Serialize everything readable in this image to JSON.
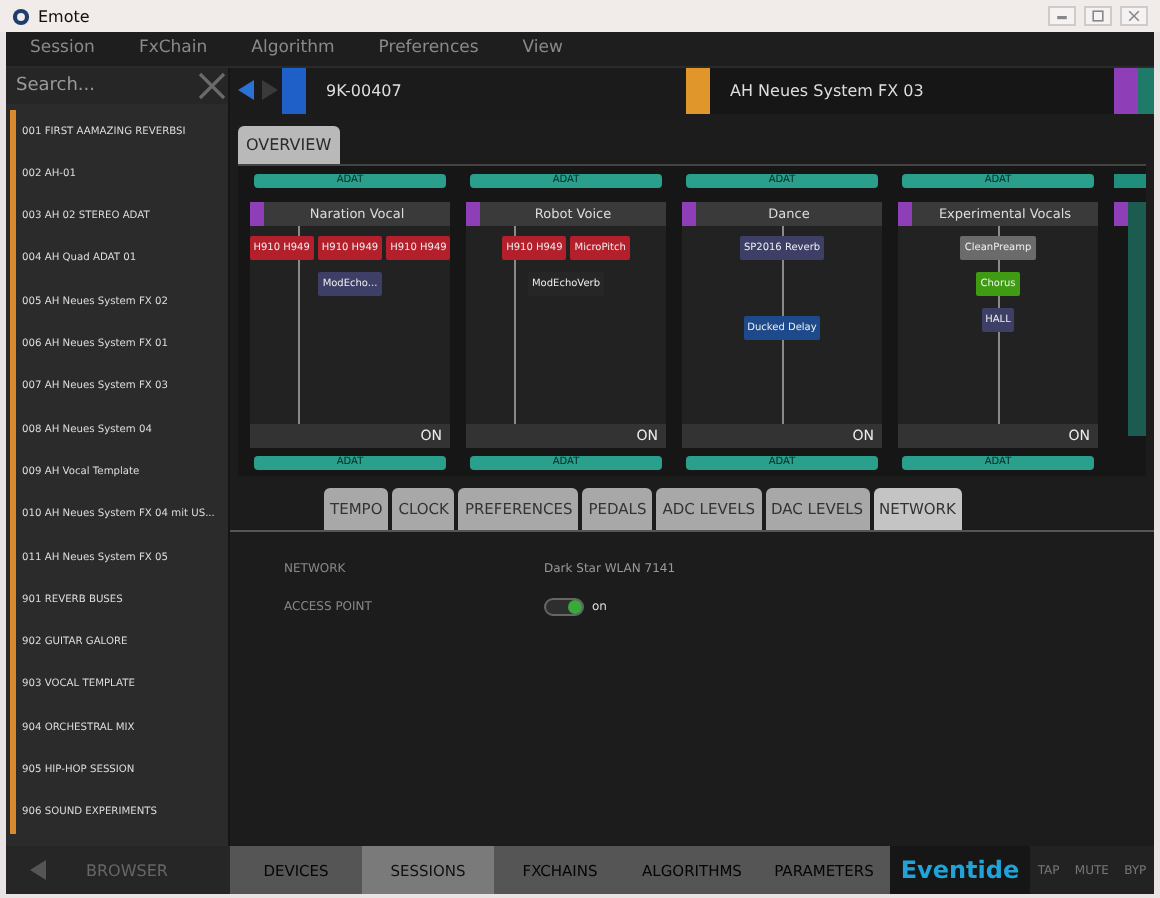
{
  "window": {
    "title": "Emote"
  },
  "menu": [
    "Session",
    "FxChain",
    "Algorithm",
    "Preferences",
    "View"
  ],
  "sidebar": {
    "search": {
      "placeholder": "Search..."
    },
    "items": [
      {
        "label": "001 FIRST AAMAZING REVERBSI",
        "selected": false
      },
      {
        "label": "002 AH-01",
        "selected": false
      },
      {
        "label": "003 AH 02 STEREO ADAT",
        "selected": false
      },
      {
        "label": "004 AH Quad ADAT 01",
        "selected": false
      },
      {
        "label": "005 AH Neues System FX  02",
        "selected": false
      },
      {
        "label": "006 AH Neues System FX 01",
        "selected": false
      },
      {
        "label": "007 AH Neues System FX 03",
        "selected": false
      },
      {
        "label": "008 AH Neues System 04",
        "selected": false
      },
      {
        "label": "009 AH Vocal Template",
        "selected": false
      },
      {
        "label": "010 AH Neues System FX 04 mit US...",
        "selected": false
      },
      {
        "label": "011 AH Neues System FX 05",
        "selected": false
      },
      {
        "label": "901 REVERB BUSES",
        "selected": false
      },
      {
        "label": "902 GUITAR GALORE",
        "selected": false
      },
      {
        "label": "903 VOCAL TEMPLATE",
        "selected": false
      },
      {
        "label": "904 ORCHESTRAL MIX",
        "selected": false
      },
      {
        "label": "905 HIP-HOP SESSION",
        "selected": false
      },
      {
        "label": "906 SOUND EXPERIMENTS",
        "selected": false
      }
    ]
  },
  "device_bar": {
    "device": {
      "label": "9K-00407",
      "color": "#1f5fc8"
    },
    "session": {
      "label": "AH Neues System FX 03",
      "color": "#e0962a"
    }
  },
  "view_tabs": [
    {
      "label": "OVERVIEW",
      "selected": true
    }
  ],
  "chains": [
    {
      "name": "Naration Vocal",
      "input": "ADAT",
      "output": "ADAT",
      "status": "ON",
      "stages": [
        {
          "blocks": [
            {
              "label": "H910 H949",
              "color": "#b3202c"
            },
            {
              "label": "H910 H949",
              "color": "#b3202c"
            },
            {
              "label": "H910 H949",
              "color": "#b3202c"
            }
          ]
        },
        {
          "blocks": [
            {
              "label": "ModEcho...",
              "color": "#3d3f66"
            }
          ]
        }
      ]
    },
    {
      "name": "Robot Voice",
      "input": "ADAT",
      "output": "ADAT",
      "status": "ON",
      "stages": [
        {
          "blocks": [
            {
              "label": "H910 H949",
              "color": "#b3202c"
            },
            {
              "label": "MicroPitch",
              "color": "#b3202c"
            }
          ]
        },
        {
          "blocks": [
            {
              "label": "ModEchoVerb",
              "color": "#262626"
            }
          ]
        }
      ]
    },
    {
      "name": "Dance",
      "input": "ADAT",
      "output": "ADAT",
      "status": "ON",
      "stages": [
        {
          "blocks": [
            {
              "label": "SP2016 Reverb",
              "color": "#3d3f66"
            }
          ]
        },
        {
          "blocks": [
            {
              "label": "Ducked Delay",
              "color": "#1e4a8c"
            }
          ]
        }
      ]
    },
    {
      "name": "Experimental Vocals",
      "input": "ADAT",
      "output": "ADAT",
      "status": "ON",
      "stages": [
        {
          "blocks": [
            {
              "label": "CleanPreamp",
              "color": "#6b6b6b"
            }
          ]
        },
        {
          "blocks": [
            {
              "label": "Chorus",
              "color": "#3f9c12"
            }
          ]
        },
        {
          "blocks": [
            {
              "label": "HALL",
              "color": "#3d3f66"
            }
          ]
        }
      ]
    }
  ],
  "settings_tabs": [
    {
      "label": "TEMPO",
      "selected": false
    },
    {
      "label": "CLOCK",
      "selected": false
    },
    {
      "label": "PREFERENCES",
      "selected": false
    },
    {
      "label": "PEDALS",
      "selected": false
    },
    {
      "label": "ADC LEVELS",
      "selected": false
    },
    {
      "label": "DAC LEVELS",
      "selected": false
    },
    {
      "label": "NETWORK",
      "selected": true
    }
  ],
  "settings": [
    {
      "kind": "text",
      "label": "NETWORK",
      "value": "Dark Star WLAN 7141"
    },
    {
      "kind": "toggle",
      "label": "ACCESS POINT",
      "on": true,
      "value": "on"
    }
  ],
  "bottom_bar": {
    "browser": "BROWSER",
    "nav": [
      {
        "label": "DEVICES",
        "selected": false
      },
      {
        "label": "SESSIONS",
        "selected": true
      },
      {
        "label": "FXCHAINS",
        "selected": false
      },
      {
        "label": "ALGORITHMS",
        "selected": false
      },
      {
        "label": "PARAMETERS",
        "selected": false
      }
    ],
    "logo": "Eventide",
    "actions": [
      "TAP",
      "MUTE",
      "BYP"
    ]
  }
}
